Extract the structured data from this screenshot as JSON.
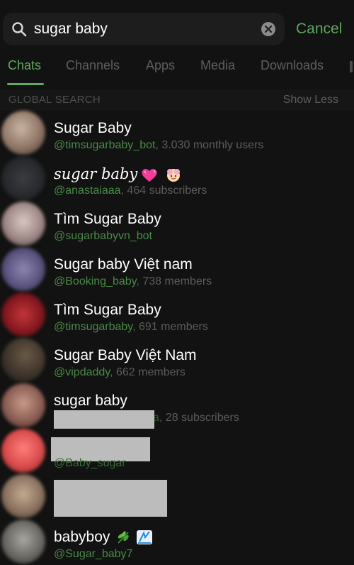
{
  "search": {
    "query": "sugar baby",
    "cancel_label": "Cancel"
  },
  "tabs": [
    {
      "label": "Chats",
      "active": true
    },
    {
      "label": "Channels",
      "active": false
    },
    {
      "label": "Apps",
      "active": false
    },
    {
      "label": "Media",
      "active": false
    },
    {
      "label": "Downloads",
      "active": false
    }
  ],
  "section": {
    "title": "GLOBAL SEARCH",
    "show_less_label": "Show Less"
  },
  "results": [
    {
      "title": "Sugar Baby",
      "handle": "@timsugarbaby_bot",
      "detail": ", 3.030 monthly users"
    },
    {
      "title": "sugar baby",
      "title_icons": [
        "pink-heart-icon",
        "cherry-blossom-face-icon"
      ],
      "handle": "@anastaiaaa",
      "detail": ", 464 subscribers"
    },
    {
      "title": "Tìm Sugar Baby",
      "handle": "@sugarbabyvn_bot",
      "detail": ""
    },
    {
      "title": "Sugar baby Việt nam",
      "handle": "@Booking_baby",
      "detail": ", 738 members"
    },
    {
      "title": "Tìm Sugar Baby",
      "handle": "@timsugarbaby",
      "detail": ", 691 members"
    },
    {
      "title": "Sugar Baby Việt Nam",
      "handle": "@vipdaddy",
      "detail": ", 662 members"
    },
    {
      "title": "sugar baby",
      "handle": "a",
      "detail": ", 28 subscribers",
      "handle_redacted": true
    },
    {
      "title": "",
      "title_redacted": true,
      "handle": "@Baby_sugar",
      "detail": ""
    },
    {
      "title": "",
      "title_redacted": true,
      "handle": "",
      "detail": ""
    },
    {
      "title": "babyboy",
      "title_icons": [
        "herb-icon",
        "flag-icon"
      ],
      "handle": "@Sugar_baby7",
      "detail": ""
    }
  ],
  "colors": {
    "background": "#111211",
    "accent": "#62a95f",
    "handle": "#4a8a48",
    "muted": "#5a5c5a",
    "redaction": "#bcbcbc"
  }
}
